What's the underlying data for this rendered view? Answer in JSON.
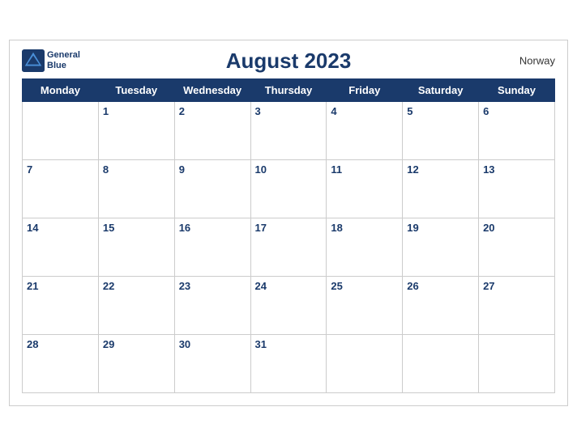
{
  "header": {
    "title": "August 2023",
    "country": "Norway",
    "logo_text_line1": "General",
    "logo_text_line2": "Blue"
  },
  "weekdays": [
    "Monday",
    "Tuesday",
    "Wednesday",
    "Thursday",
    "Friday",
    "Saturday",
    "Sunday"
  ],
  "weeks": [
    [
      {
        "day": "",
        "empty": true
      },
      {
        "day": "1"
      },
      {
        "day": "2"
      },
      {
        "day": "3"
      },
      {
        "day": "4"
      },
      {
        "day": "5"
      },
      {
        "day": "6"
      }
    ],
    [
      {
        "day": "7"
      },
      {
        "day": "8"
      },
      {
        "day": "9"
      },
      {
        "day": "10"
      },
      {
        "day": "11"
      },
      {
        "day": "12"
      },
      {
        "day": "13"
      }
    ],
    [
      {
        "day": "14"
      },
      {
        "day": "15"
      },
      {
        "day": "16"
      },
      {
        "day": "17"
      },
      {
        "day": "18"
      },
      {
        "day": "19"
      },
      {
        "day": "20"
      }
    ],
    [
      {
        "day": "21"
      },
      {
        "day": "22"
      },
      {
        "day": "23"
      },
      {
        "day": "24"
      },
      {
        "day": "25"
      },
      {
        "day": "26"
      },
      {
        "day": "27"
      }
    ],
    [
      {
        "day": "28"
      },
      {
        "day": "29"
      },
      {
        "day": "30"
      },
      {
        "day": "31"
      },
      {
        "day": "",
        "empty": true
      },
      {
        "day": "",
        "empty": true
      },
      {
        "day": "",
        "empty": true
      }
    ]
  ]
}
